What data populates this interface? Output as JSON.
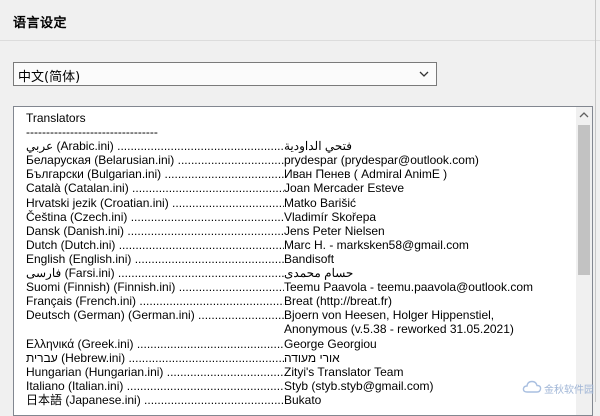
{
  "title": "语言设定",
  "language_select": {
    "value": "中文(简体)",
    "icon": "chevron-down-icon"
  },
  "translators": {
    "header": "Translators",
    "separator": "---------------------------------",
    "entries": [
      {
        "language": "عربي (Arabic.ini) ..................................................",
        "translator": "فتحي الداودية"
      },
      {
        "language": "Беларуская (Belarusian.ini) ......................................",
        "translator": "prydespar (prydespar@outlook.com)"
      },
      {
        "language": "Български (Bulgarian.ini) ........................................",
        "translator": "Иван Пенев ( Admiral AnimE )"
      },
      {
        "language": "Català (Catalan.ini) ..................................................",
        "translator": "Joan Mercader Esteve"
      },
      {
        "language": "Hrvatski jezik (Croatian.ini) ....................................",
        "translator": "Matko Barišić"
      },
      {
        "language": "Čeština (Czech.ini) .................................................",
        "translator": "Vladimír Skořepa"
      },
      {
        "language": "Dansk (Danish.ini) ..................................................",
        "translator": "Jens Peter Nielsen"
      },
      {
        "language": "Dutch (Dutch.ini) ....................................................",
        "translator": "Marc H. - marksken58@gmail.com"
      },
      {
        "language": "English (English.ini) ................................................",
        "translator": "Bandisoft"
      },
      {
        "language": "فارسی (Farsi.ini) ......................................................",
        "translator": "حسام محمدی"
      },
      {
        "language": "Suomi (Finnish) (Finnish.ini) .......................................",
        "translator": "Teemu Paavola - teemu.paavola@outlook.com"
      },
      {
        "language": "Français (French.ini) ...............................................",
        "translator": "Breat (http://breat.fr)"
      },
      {
        "language": "Deutsch (German) (German.ini) ..................................",
        "translator": "Bjoern von Heesen, Holger Hippenstiel,"
      },
      {
        "language": "",
        "translator": "Anonymous (v.5.38 - reworked 31.05.2021)"
      },
      {
        "language": "Ελληνικά (Greek.ini) .................................................",
        "translator": "George Georgiou"
      },
      {
        "language": "עברית (Hebrew.ini) .................................................",
        "translator": "אורי מעודה"
      },
      {
        "language": "Hungarian (Hungarian.ini) .........................................",
        "translator": "Zityi's Translator Team"
      },
      {
        "language": "Italiano (Italian.ini) ..................................................",
        "translator": "Styb (styb.styb@gmail.com)"
      },
      {
        "language": "日本語 (Japanese.ini) .............................................",
        "translator": "Bukato"
      }
    ]
  },
  "watermark": {
    "text": "金秋软件园",
    "icon": "cloud-logo-icon"
  }
}
